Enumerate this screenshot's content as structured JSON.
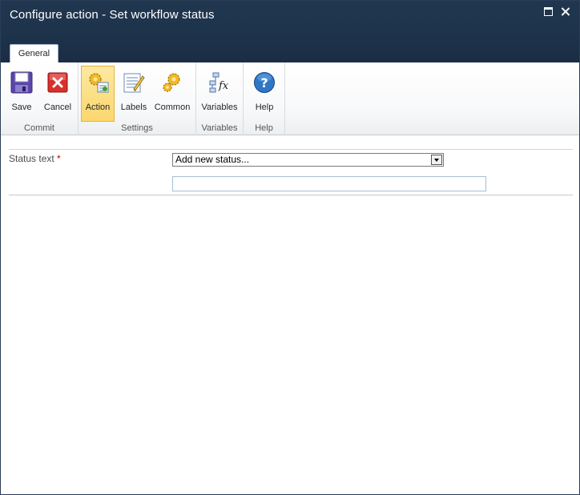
{
  "window": {
    "title": "Configure action - Set workflow status"
  },
  "tabs": [
    {
      "label": "General"
    }
  ],
  "ribbon": {
    "groups": [
      {
        "label": "Commit",
        "buttons": [
          {
            "label": "Save",
            "icon": "save-icon"
          },
          {
            "label": "Cancel",
            "icon": "cancel-icon"
          }
        ]
      },
      {
        "label": "Settings",
        "buttons": [
          {
            "label": "Action",
            "icon": "action-gears-icon",
            "active": true
          },
          {
            "label": "Labels",
            "icon": "labels-icon"
          },
          {
            "label": "Common",
            "icon": "common-gears-icon"
          }
        ]
      },
      {
        "label": "Variables",
        "buttons": [
          {
            "label": "Variables",
            "icon": "variables-fx-icon"
          }
        ]
      },
      {
        "label": "Help",
        "buttons": [
          {
            "label": "Help",
            "icon": "help-icon"
          }
        ]
      }
    ]
  },
  "form": {
    "status_label": "Status text",
    "required_marker": "*",
    "status_select_value": "Add new status...",
    "new_status_value": ""
  },
  "colors": {
    "titlebar": "#1d324b",
    "active_button": "#fbd76d",
    "required": "#c00000"
  }
}
